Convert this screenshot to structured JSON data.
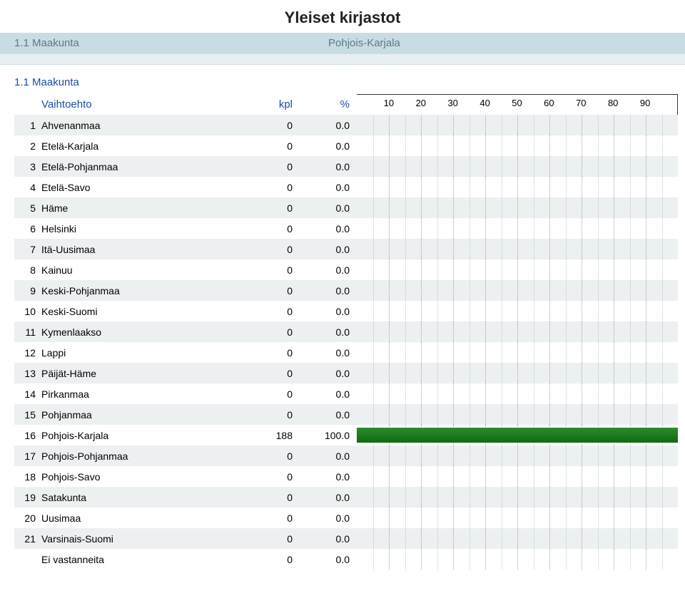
{
  "title": "Yleiset kirjastot",
  "subhead": {
    "left": "1.1 Maakunta",
    "right": "Pohjois-Karjala"
  },
  "section_label": "1.1 Maakunta",
  "table": {
    "head": {
      "option": "Vaihtoehto",
      "kpl": "kpl",
      "pct": "%"
    },
    "rows": [
      {
        "idx": "1",
        "name": "Ahvenanmaa",
        "kpl": "0",
        "pct": "0.0"
      },
      {
        "idx": "2",
        "name": "Etelä-Karjala",
        "kpl": "0",
        "pct": "0.0"
      },
      {
        "idx": "3",
        "name": "Etelä-Pohjanmaa",
        "kpl": "0",
        "pct": "0.0"
      },
      {
        "idx": "4",
        "name": "Etelä-Savo",
        "kpl": "0",
        "pct": "0.0"
      },
      {
        "idx": "5",
        "name": "Häme",
        "kpl": "0",
        "pct": "0.0"
      },
      {
        "idx": "6",
        "name": "Helsinki",
        "kpl": "0",
        "pct": "0.0"
      },
      {
        "idx": "7",
        "name": "Itä-Uusimaa",
        "kpl": "0",
        "pct": "0.0"
      },
      {
        "idx": "8",
        "name": "Kainuu",
        "kpl": "0",
        "pct": "0.0"
      },
      {
        "idx": "9",
        "name": "Keski-Pohjanmaa",
        "kpl": "0",
        "pct": "0.0"
      },
      {
        "idx": "10",
        "name": "Keski-Suomi",
        "kpl": "0",
        "pct": "0.0"
      },
      {
        "idx": "11",
        "name": "Kymenlaakso",
        "kpl": "0",
        "pct": "0.0"
      },
      {
        "idx": "12",
        "name": "Lappi",
        "kpl": "0",
        "pct": "0.0"
      },
      {
        "idx": "13",
        "name": "Päijät-Häme",
        "kpl": "0",
        "pct": "0.0"
      },
      {
        "idx": "14",
        "name": "Pirkanmaa",
        "kpl": "0",
        "pct": "0.0"
      },
      {
        "idx": "15",
        "name": "Pohjanmaa",
        "kpl": "0",
        "pct": "0.0"
      },
      {
        "idx": "16",
        "name": "Pohjois-Karjala",
        "kpl": "188",
        "pct": "100.0"
      },
      {
        "idx": "17",
        "name": "Pohjois-Pohjanmaa",
        "kpl": "0",
        "pct": "0.0"
      },
      {
        "idx": "18",
        "name": "Pohjois-Savo",
        "kpl": "0",
        "pct": "0.0"
      },
      {
        "idx": "19",
        "name": "Satakunta",
        "kpl": "0",
        "pct": "0.0"
      },
      {
        "idx": "20",
        "name": "Uusimaa",
        "kpl": "0",
        "pct": "0.0"
      },
      {
        "idx": "21",
        "name": "Varsinais-Suomi",
        "kpl": "0",
        "pct": "0.0"
      },
      {
        "idx": "",
        "name": "Ei vastanneita",
        "kpl": "0",
        "pct": "0.0"
      }
    ]
  },
  "chart": {
    "ticks": [
      10,
      20,
      30,
      40,
      50,
      60,
      70,
      80,
      90
    ],
    "max": 100
  },
  "chart_data": {
    "type": "bar",
    "orientation": "horizontal",
    "title": "1.1 Maakunta — Pohjois-Karjala",
    "xlabel": "%",
    "ylabel": "Vaihtoehto",
    "xlim": [
      0,
      100
    ],
    "categories": [
      "Ahvenanmaa",
      "Etelä-Karjala",
      "Etelä-Pohjanmaa",
      "Etelä-Savo",
      "Häme",
      "Helsinki",
      "Itä-Uusimaa",
      "Kainuu",
      "Keski-Pohjanmaa",
      "Keski-Suomi",
      "Kymenlaakso",
      "Lappi",
      "Päijät-Häme",
      "Pirkanmaa",
      "Pohjanmaa",
      "Pohjois-Karjala",
      "Pohjois-Pohjanmaa",
      "Pohjois-Savo",
      "Satakunta",
      "Uusimaa",
      "Varsinais-Suomi",
      "Ei vastanneita"
    ],
    "series": [
      {
        "name": "%",
        "values": [
          0,
          0,
          0,
          0,
          0,
          0,
          0,
          0,
          0,
          0,
          0,
          0,
          0,
          0,
          0,
          100.0,
          0,
          0,
          0,
          0,
          0,
          0
        ]
      },
      {
        "name": "kpl",
        "values": [
          0,
          0,
          0,
          0,
          0,
          0,
          0,
          0,
          0,
          0,
          0,
          0,
          0,
          0,
          0,
          188,
          0,
          0,
          0,
          0,
          0,
          0
        ]
      }
    ]
  }
}
